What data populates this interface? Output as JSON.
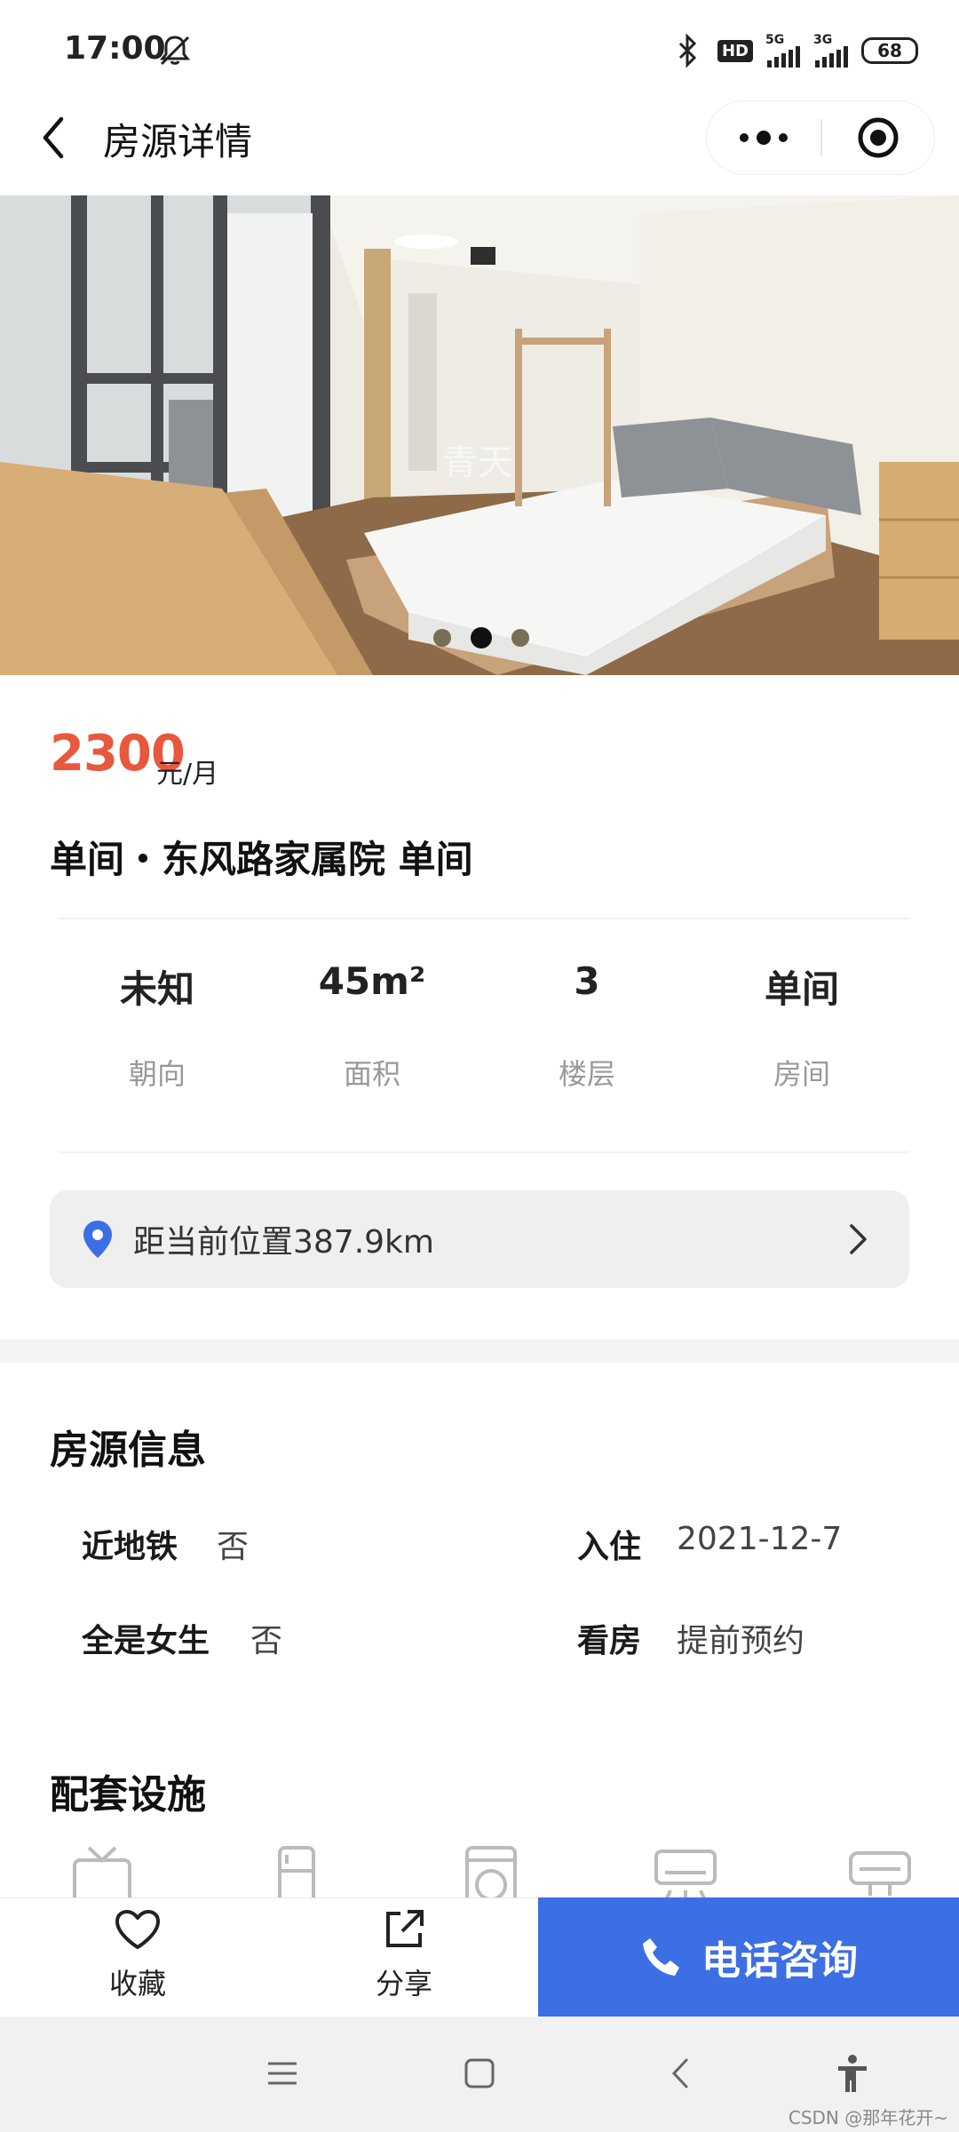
{
  "status_bar": {
    "time": "17:00",
    "hd_label": "HD",
    "net1": "5G",
    "net2": "3G",
    "battery": "68"
  },
  "header": {
    "title": "房源详情"
  },
  "photo": {
    "watermark": "青天",
    "carousel_slides": 3,
    "carousel_active_index": 1
  },
  "listing": {
    "price": "2300",
    "price_unit": "元/月",
    "title": "单间・东风路家属院 单间",
    "stats": [
      {
        "value": "未知",
        "label": "朝向"
      },
      {
        "value": "45m²",
        "label": "面积"
      },
      {
        "value": "3",
        "label": "楼层"
      },
      {
        "value": "单间",
        "label": "房间"
      }
    ],
    "location_text": "距当前位置387.9km"
  },
  "info_section": {
    "title": "房源信息",
    "items": [
      {
        "key": "近地铁",
        "value": "否"
      },
      {
        "key": "入住",
        "value": "2021-12-7"
      },
      {
        "key": "全是女生",
        "value": "否"
      },
      {
        "key": "看房",
        "value": "提前预约"
      }
    ]
  },
  "facilities_section": {
    "title": "配套设施",
    "icons": [
      "tv-icon",
      "fridge-icon",
      "washing-machine-icon",
      "air-conditioner-icon",
      "water-heater-icon"
    ]
  },
  "action_bar": {
    "favorite_label": "收藏",
    "share_label": "分享",
    "call_label": "电话咨询",
    "call_color": "#3d6fe4",
    "price_color": "#e8583d"
  },
  "footer": {
    "credit": "CSDN @那年花开~"
  }
}
